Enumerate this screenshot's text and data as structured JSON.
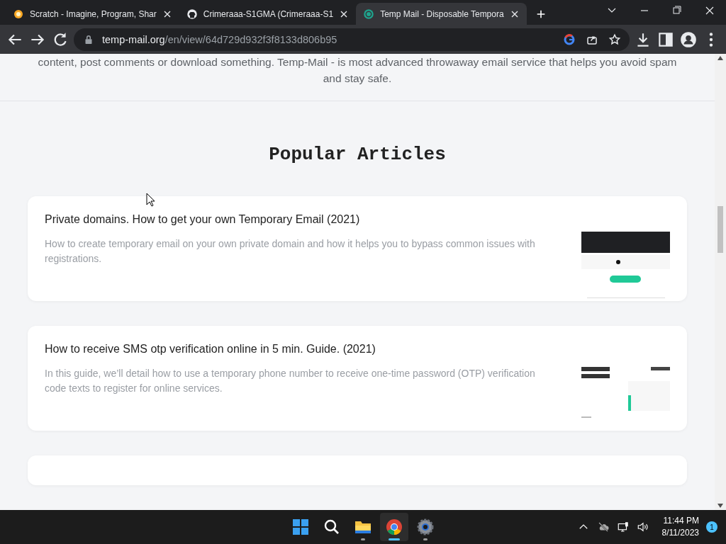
{
  "browser": {
    "tabs": [
      {
        "title": "Scratch - Imagine, Program, Shar",
        "selected": false
      },
      {
        "title": "Crimeraaa-S1GMA (Crimeraaa-S1",
        "selected": false
      },
      {
        "title": "Temp Mail - Disposable Tempora",
        "selected": true
      }
    ],
    "address": {
      "domain": "temp-mail.org",
      "path": "/en/view/64d729d932f3f8133d806b95"
    }
  },
  "page": {
    "intro": [
      "content, post comments or download something. Temp-Mail - is most advanced throwaway email service that helps you avoid spam",
      "and stay safe."
    ],
    "section_title": "Popular Articles",
    "articles": [
      {
        "title": "Private domains. How to get your own Temporary Email (2021)",
        "description": "How to create temporary email on your own private domain and how it helps you to bypass common issues with registrations."
      },
      {
        "title": "How to receive SMS otp verification online in 5 min. Guide. (2021)",
        "description": "In this guide, we’ll detail how to use a temporary phone number to receive one-time password (OTP) verification code texts to register for online services."
      }
    ]
  },
  "taskbar": {
    "apps": [
      {
        "kind": "start",
        "running": false,
        "selected": false
      },
      {
        "kind": "search",
        "running": false,
        "selected": false
      },
      {
        "kind": "folder",
        "running": true,
        "selected": false
      },
      {
        "kind": "chrome",
        "running": true,
        "selected": true
      },
      {
        "kind": "settings",
        "running": true,
        "selected": false
      }
    ],
    "time": "11:44 PM",
    "date": "8/11/2023",
    "notifications": "1"
  }
}
